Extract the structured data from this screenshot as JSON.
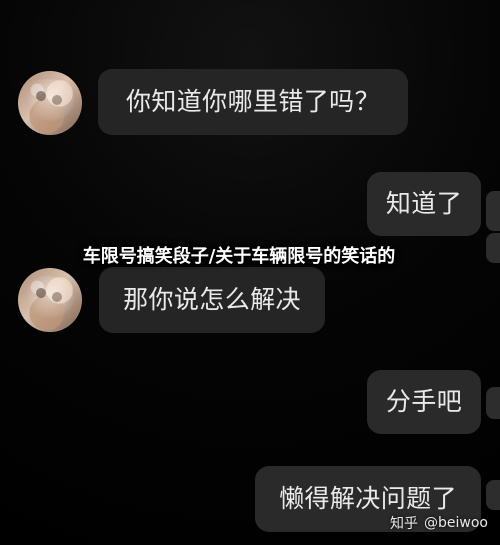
{
  "messages": [
    {
      "text": "你知道你哪里错了吗？"
    },
    {
      "text": "知道了"
    },
    {
      "text": "那你说怎么解决"
    },
    {
      "text": "分手吧"
    },
    {
      "text": "懒得解决问题了"
    }
  ],
  "overlay_title": "车限号搞笑段子/关于车辆限号的笑话的",
  "watermark": {
    "platform": "知乎",
    "user": "@beiwoo"
  }
}
